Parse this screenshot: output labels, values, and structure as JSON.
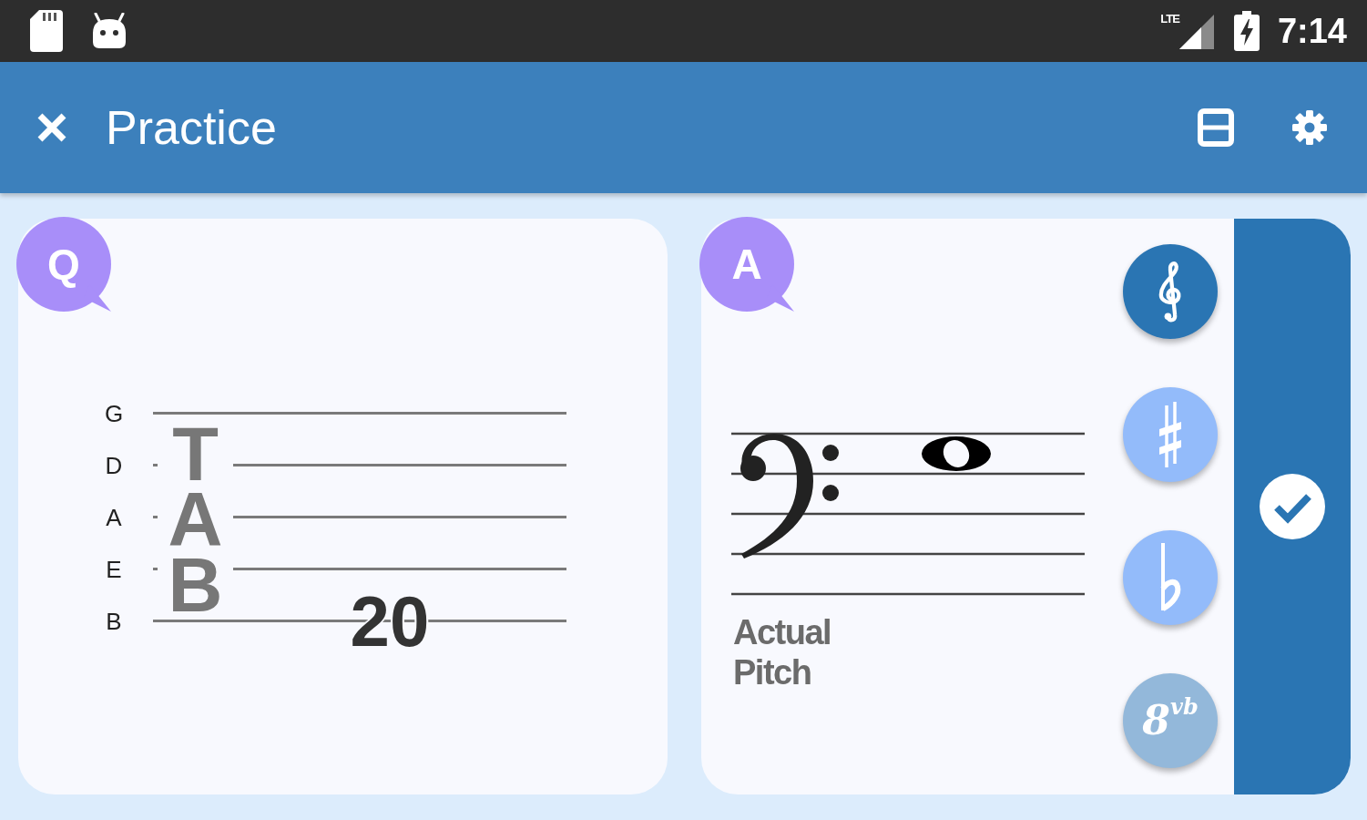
{
  "status_bar": {
    "network": "LTE",
    "time": "7:14"
  },
  "app_bar": {
    "title": "Practice"
  },
  "question": {
    "badge": "Q",
    "tab_label": "TAB",
    "strings": [
      {
        "name": "G"
      },
      {
        "name": "D"
      },
      {
        "name": "A"
      },
      {
        "name": "E"
      },
      {
        "name": "B",
        "fret": "20"
      }
    ]
  },
  "answer": {
    "badge": "A",
    "label": "Actual Pitch",
    "tools": [
      {
        "kind": "treble_clef",
        "selected": true,
        "disabled": false
      },
      {
        "kind": "sharp",
        "selected": false,
        "disabled": false
      },
      {
        "kind": "flat",
        "selected": false,
        "disabled": false
      },
      {
        "kind": "octave",
        "label": "8$^{vb}$",
        "selected": false,
        "disabled": true
      }
    ]
  }
}
